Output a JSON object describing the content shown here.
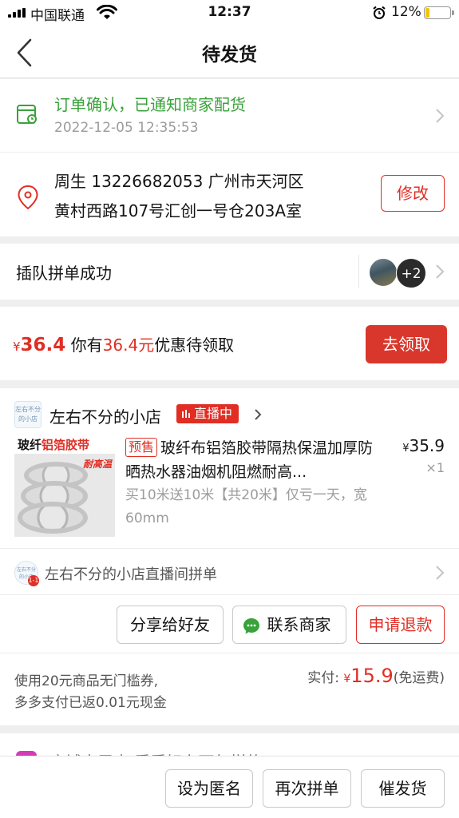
{
  "status_bar": {
    "carrier": "中国联通",
    "time": "12:37",
    "battery": "12%",
    "battery_level_percent": 12,
    "icons": [
      "signal-icon",
      "wifi-icon",
      "alarm-icon",
      "battery-icon"
    ]
  },
  "nav": {
    "title": "待发货",
    "back_icon": "chevron-left-icon"
  },
  "order_status": {
    "status_text": "订单确认，已通知商家配货",
    "status_time": "2022-12-05 12:35:53",
    "address_line1": "周生  13226682053  广州市天河区",
    "address_line2": "黄村西路107号汇创一号仓203A室",
    "edit_label": "修改",
    "colors": {
      "status_green": "#39a23a"
    }
  },
  "group": {
    "label": "插队拼单成功",
    "extra_count": "+2"
  },
  "coupon": {
    "currency": "¥",
    "amount": "36.4",
    "text_prefix": "你有",
    "text_amount": "36.4元",
    "text_suffix": "优惠待领取",
    "claim_label": "去领取",
    "colors": {
      "accent_red": "#e02e24",
      "claim_bg": "#d9372c"
    }
  },
  "shop": {
    "name": "左右不分的小店",
    "logo_text": "左右不分的小店",
    "live_label": "直播中",
    "goods": {
      "image_banner_black": "玻纤",
      "image_banner_red": "铝箔胶带",
      "image_tag": "耐高温",
      "presale_tag": "预售",
      "title": "玻纤布铝箔胶带隔热保温加厚防晒热水器油烟机阻燃耐高...",
      "spec": "买10米送10米【共20米】仅亏一天，宽60mm",
      "currency": "¥",
      "price": "35.9",
      "quantity": "×1"
    },
    "live_room_text": "左右不分的小店直播间拼单",
    "live_room_badge": "1-1",
    "share_label": "分享给好友",
    "contact_label": "联系商家",
    "refund_label": "申请退款",
    "pay_note_line1": "使用20元商品无门槛券,",
    "pay_note_line2": "多多支付已返0.01元现金",
    "paid_label": "实付:",
    "paid_currency": "¥",
    "paid_amount": "15.9",
    "paid_suffix": "(免运费)"
  },
  "peek": {
    "text": "店铺大甩卖  看看好东西怎样的"
  },
  "bottom_bar": {
    "anonymous_label": "设为匿名",
    "rebuy_label": "再次拼单",
    "urge_label": "催发货"
  }
}
